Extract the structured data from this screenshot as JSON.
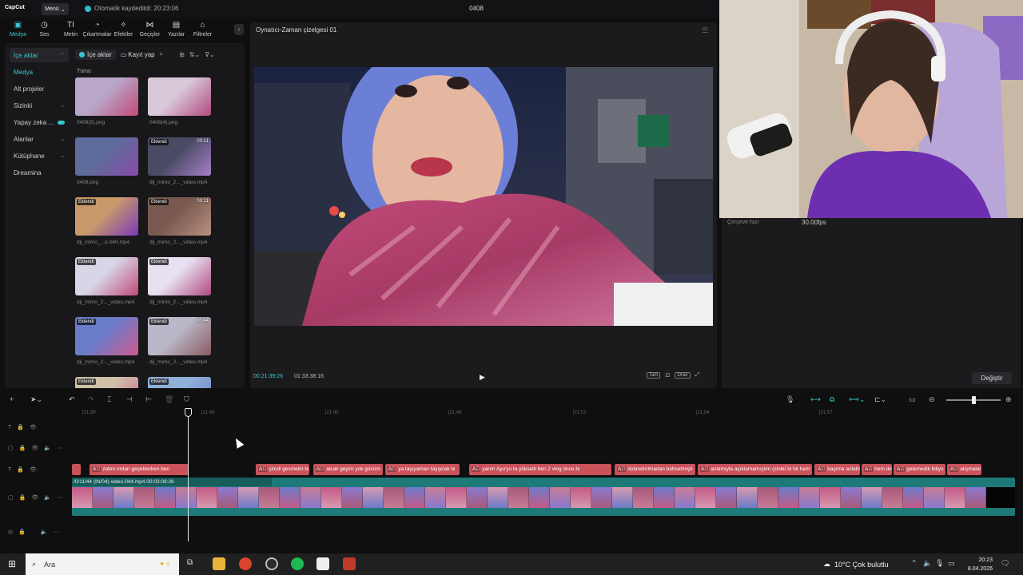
{
  "app": {
    "logo": "CapCut",
    "menu_label": "Menü",
    "autosave": "Otomatik kaydedildi: 20:23:06",
    "project_title": "0408"
  },
  "tool_tabs": [
    "Medya",
    "Ses",
    "Metin",
    "Çıkartmalar",
    "Efektler",
    "Geçişler",
    "Yazılar",
    "Filtreler"
  ],
  "side_nav": [
    {
      "label": "İçe aktar",
      "chev": "⌃"
    },
    {
      "label": "Medya",
      "chev": ""
    },
    {
      "label": "Alt projeler",
      "chev": ""
    },
    {
      "label": "Sizinki",
      "chev": "⌄"
    },
    {
      "label": "Yapay zeka ...",
      "chev": ""
    },
    {
      "label": "Alanlar",
      "chev": "⌄"
    },
    {
      "label": "Kütüphane",
      "chev": "⌄"
    },
    {
      "label": "Dreamina",
      "chev": ""
    }
  ],
  "media_toolbar": {
    "import": "İçe aktar",
    "record": "Kayıt yap"
  },
  "all_label": "Tümü",
  "media_items": [
    {
      "name": "0408(5).png",
      "tag": "",
      "dur": ""
    },
    {
      "name": "0408(4).png",
      "tag": "",
      "dur": ""
    },
    {
      "name": "0408.png",
      "tag": "",
      "dur": ""
    },
    {
      "name": "dji_mimo_2..._video.mp4",
      "tag": "Eklendi",
      "dur": "00:11"
    },
    {
      "name": "dji_mimo_...o-040.mp4",
      "tag": "Eklendi",
      "dur": ""
    },
    {
      "name": "dji_mimo_2..._video.mp4",
      "tag": "Eklendi",
      "dur": "00:11"
    },
    {
      "name": "dji_mimo_2..._video.mp4",
      "tag": "Eklendi",
      "dur": ""
    },
    {
      "name": "dji_mimo_2..._video.mp4",
      "tag": "Eklendi",
      "dur": ""
    },
    {
      "name": "dji_mimo_2..._video.mp4",
      "tag": "Eklendi",
      "dur": ""
    },
    {
      "name": "dji_mimo_2..._video.mp4",
      "tag": "Eklendi",
      "dur": "00:44"
    },
    {
      "name": "",
      "tag": "Eklendi",
      "dur": ""
    },
    {
      "name": "",
      "tag": "Eklendi",
      "dur": ""
    }
  ],
  "player": {
    "title": "Oynatıcı-Zaman çizelgesi 01",
    "time_current": "00:21:39:26",
    "time_total": "01:33:38:16",
    "btn_full": "Tam",
    "btn_ratio": "Oran"
  },
  "properties": {
    "frame_rate_label": "Çerçeve hızı",
    "frame_rate_value": "30.00fps",
    "change_btn": "Değiştir"
  },
  "timeline": {
    "ticks": [
      "|21:39",
      "|21:43",
      "|21:45",
      "|21:48",
      "|21:51",
      "|21:54",
      "|21:57"
    ],
    "video_clip_label": "/0/11/44 (IN/04) video-044.mp4  00:03:08:26",
    "captions": [
      "",
      "zaten ordan geçeklerken ben",
      "şimdi gesmeim bi",
      "alcak geyim yok gücüm",
      "ya taşıyaman taşıycak bi",
      "yarım Ayu'yu ta yükselti ben 2 vlog önce bi",
      "dolandırılmadan bahsetmişti",
      "anlamıyla açıklamamıştım çünkü bi tık hem",
      "başıma anlattı",
      "hem de",
      "gelemedik biliyo",
      "alışmalar"
    ]
  },
  "taskbar": {
    "search_placeholder": "Ara",
    "weather": "10°C  Çok bulutlu",
    "time": "20:23",
    "date": "8.04.2026"
  },
  "colors": {
    "accent": "#39c6d1",
    "caption": "#c9525b",
    "video_track": "#1e7a78"
  }
}
